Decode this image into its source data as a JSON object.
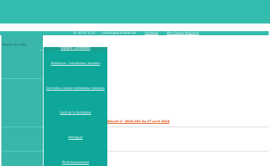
{
  "topbar": {
    "phone": "01 40 65 12 47",
    "email": "contact@tout-facile.net",
    "facebook": "Facebook",
    "magazine": "Mon Espace Magazine"
  },
  "sidebar": {
    "search_label": "Search the Site",
    "arrow": "▸",
    "bullet": "•"
  },
  "menu": {
    "header": "Espace Candidats",
    "items": [
      "Profession : Installateur dentaire",
      "Formation initiale Installateur dentaire",
      "Coût de la formation",
      "Prérequis",
      "Perfectionnement"
    ]
  },
  "content": {
    "decree_link": "Décret n° 2024-392 du 27 avril 2024"
  },
  "colors": {
    "header": "#33bbae",
    "sidebar": "#39b5a9",
    "menu": "#0ea79a",
    "link_orange": "#e0531a"
  }
}
